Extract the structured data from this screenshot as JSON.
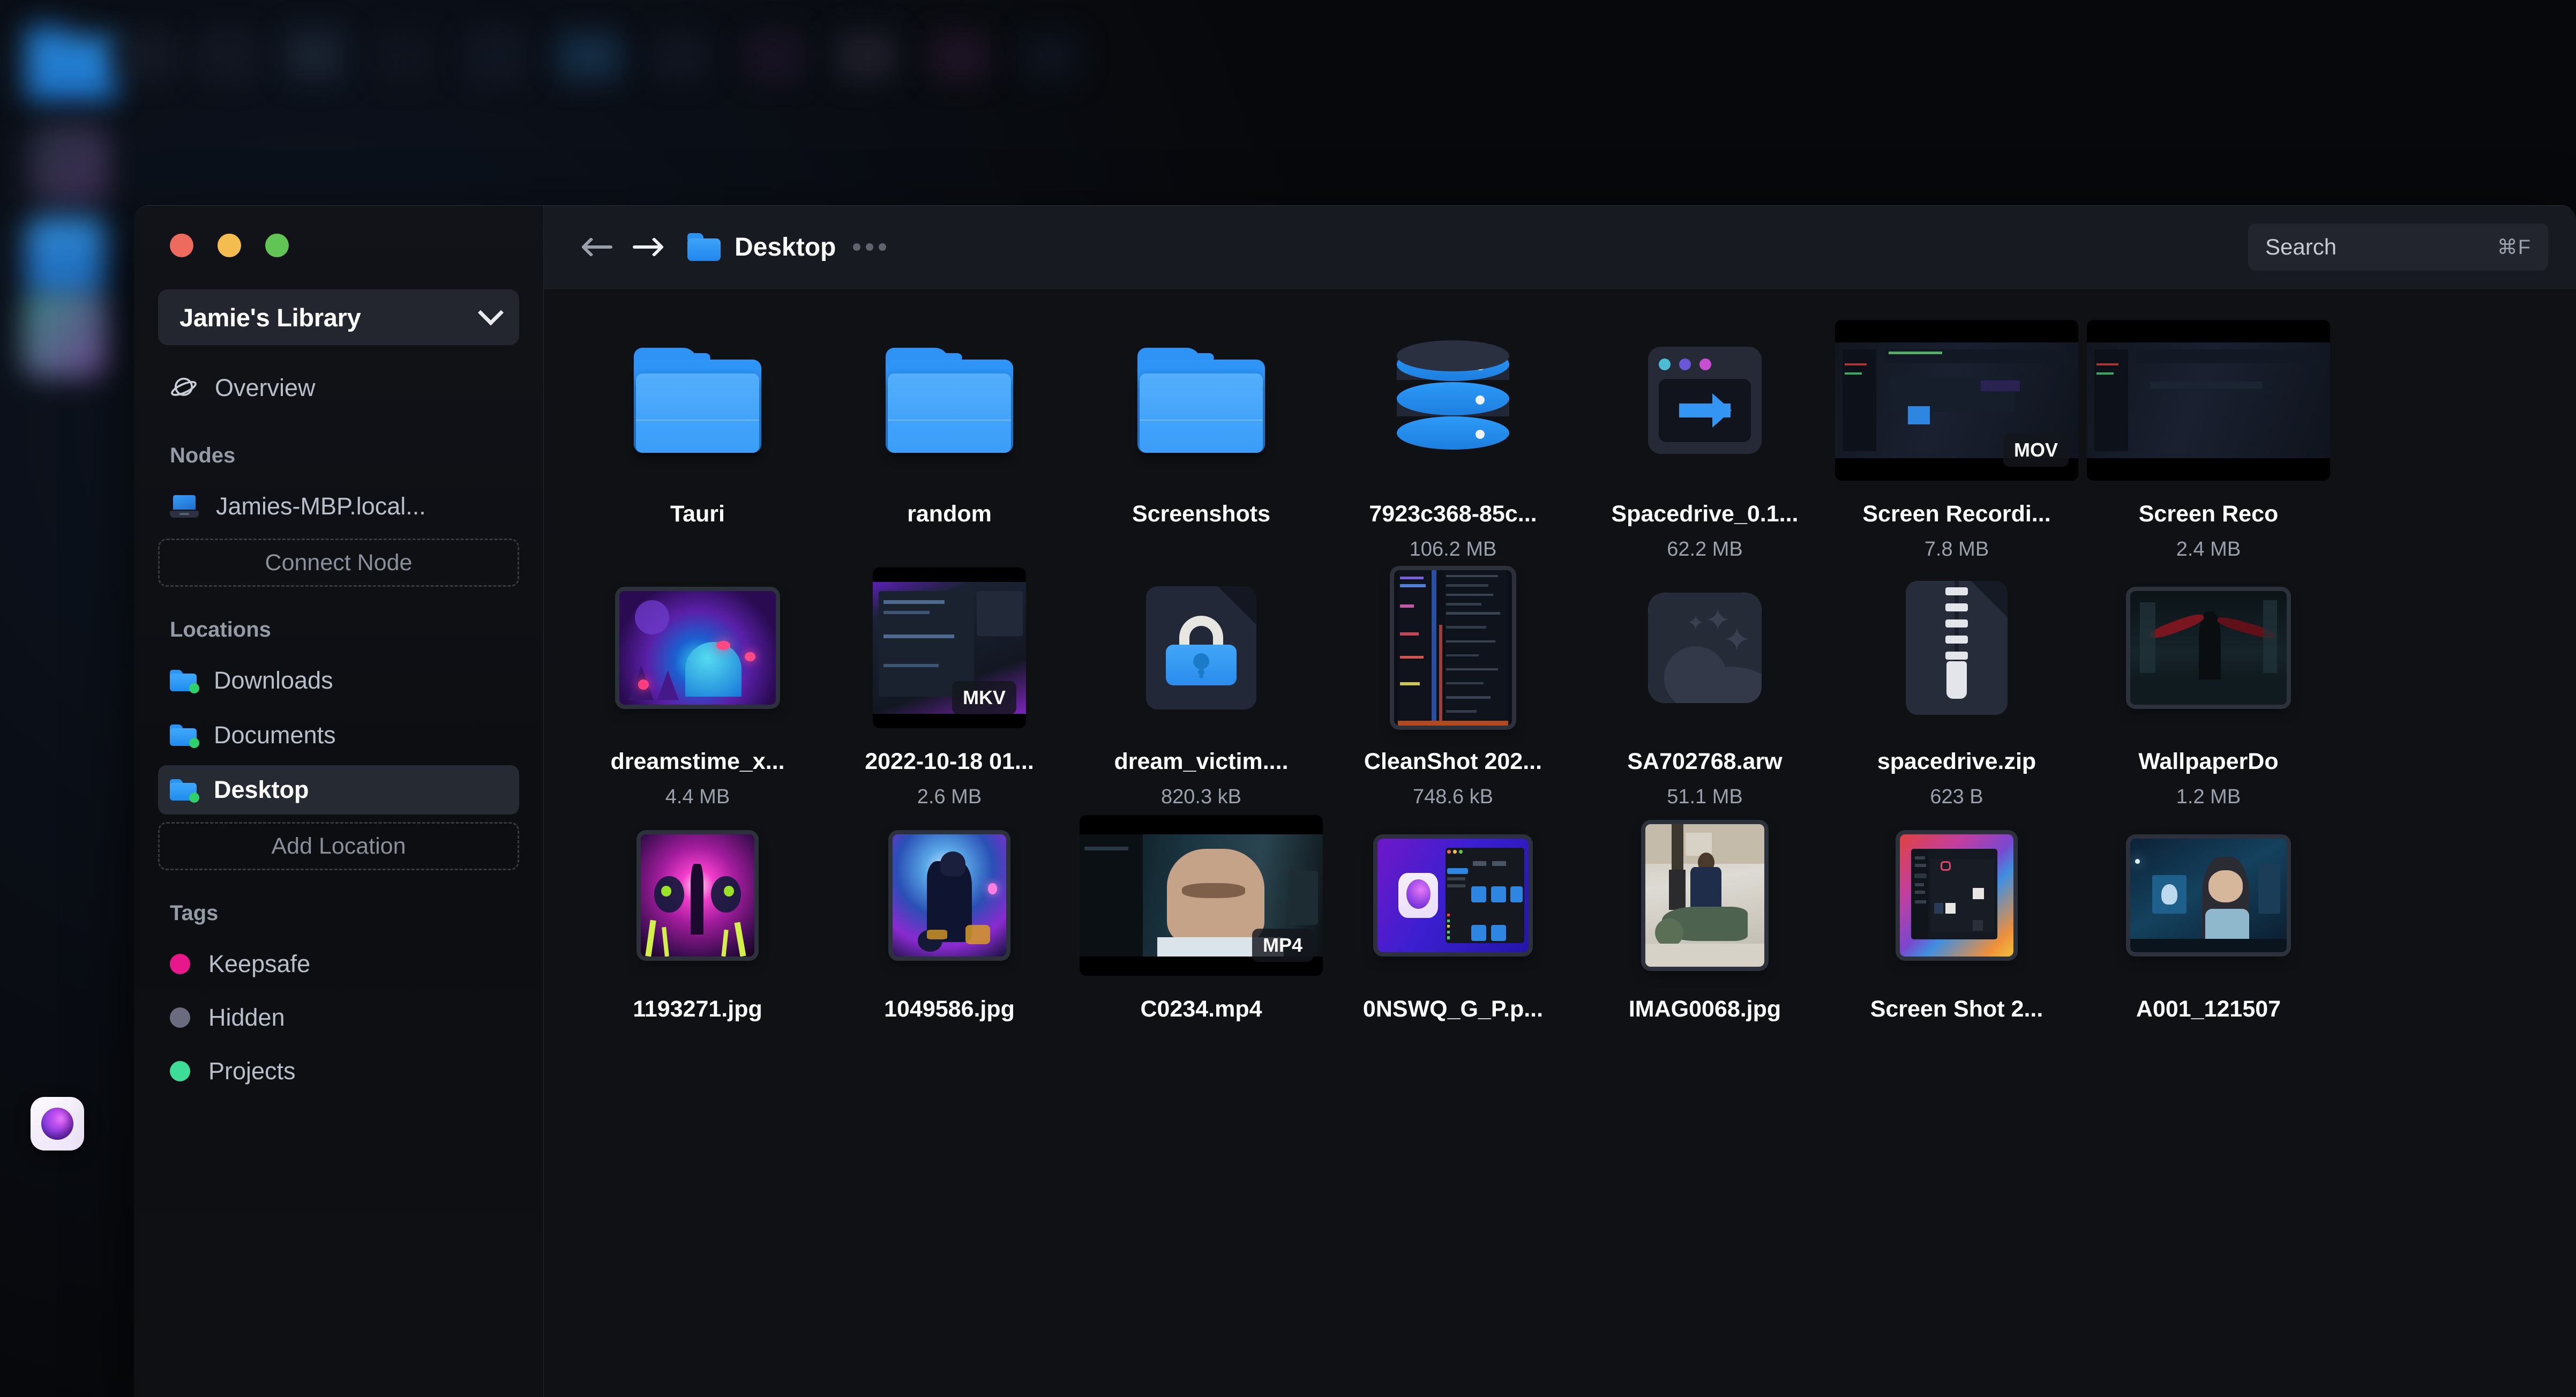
{
  "app": {
    "dock_icon_name": "spacedrive-app-icon"
  },
  "window": {
    "traffic_lights": [
      "close",
      "minimize",
      "zoom"
    ],
    "traffic_colors": {
      "close": "#ec6a5e",
      "minimize": "#f4bd4f",
      "zoom": "#61c454"
    }
  },
  "sidebar": {
    "library_switcher": {
      "label": "Jamie's Library",
      "chevron": "chevron-down-icon"
    },
    "overview": {
      "label": "Overview",
      "icon": "planet-icon"
    },
    "sections": [
      {
        "title": "Nodes",
        "items": [
          {
            "label": "Jamies-MBP.local...",
            "icon": "laptop-icon"
          }
        ],
        "action": "Connect Node"
      },
      {
        "title": "Locations",
        "items": [
          {
            "label": "Downloads",
            "icon": "folder-icon",
            "selected": false
          },
          {
            "label": "Documents",
            "icon": "folder-icon",
            "selected": false
          },
          {
            "label": "Desktop",
            "icon": "folder-icon",
            "selected": true
          }
        ],
        "action": "Add Location"
      },
      {
        "title": "Tags",
        "tags": [
          {
            "label": "Keepsafe",
            "color": "#e8188c"
          },
          {
            "label": "Hidden",
            "color": "#6b6b80"
          },
          {
            "label": "Projects",
            "color": "#3ddc97"
          }
        ]
      }
    ]
  },
  "toolbar": {
    "back": "back-arrow",
    "forward": "forward-arrow",
    "breadcrumb": {
      "label": "Desktop",
      "icon": "folder-icon"
    },
    "overflow": "more-options",
    "search": {
      "placeholder": "Search",
      "value": "",
      "shortcut": "⌘F"
    }
  },
  "files": [
    {
      "name": "Tauri",
      "size": "",
      "kind": "folder"
    },
    {
      "name": "random",
      "size": "",
      "kind": "folder"
    },
    {
      "name": "Screenshots",
      "size": "",
      "kind": "folder"
    },
    {
      "name": "7923c368-85c...",
      "size": "106.2 MB",
      "kind": "database"
    },
    {
      "name": "Spacedrive_0.1...",
      "size": "62.2 MB",
      "kind": "dmg"
    },
    {
      "name": "Screen Recordi...",
      "size": "7.8 MB",
      "kind": "video",
      "badge": "MOV"
    },
    {
      "name": "Screen Reco",
      "size": "2.4 MB",
      "kind": "video",
      "badge": ""
    },
    {
      "name": "dreamstime_x...",
      "size": "4.4 MB",
      "kind": "image-neon"
    },
    {
      "name": "2022-10-18 01...",
      "size": "2.6 MB",
      "kind": "video",
      "badge": "MKV"
    },
    {
      "name": "dream_victim....",
      "size": "820.3 kB",
      "kind": "locked-doc"
    },
    {
      "name": "CleanShot 202...",
      "size": "748.6 kB",
      "kind": "image-code"
    },
    {
      "name": "SA702768.arw",
      "size": "51.1 MB",
      "kind": "raw-image"
    },
    {
      "name": "spacedrive.zip",
      "size": "623 B",
      "kind": "zip"
    },
    {
      "name": "WallpaperDo",
      "size": "1.2 MB",
      "kind": "image-dark"
    },
    {
      "name": "1193271.jpg",
      "size": "",
      "kind": "image-magenta"
    },
    {
      "name": "1049586.jpg",
      "size": "",
      "kind": "image-blue"
    },
    {
      "name": "C0234.mp4",
      "size": "",
      "kind": "video",
      "badge": "MP4"
    },
    {
      "name": "0NSWQ_G_P.p...",
      "size": "",
      "kind": "image-purple-ui"
    },
    {
      "name": "IMAG0068.jpg",
      "size": "",
      "kind": "image-photo"
    },
    {
      "name": "Screen Shot 2...",
      "size": "",
      "kind": "image-macos"
    },
    {
      "name": "A001_121507",
      "size": "",
      "kind": "image-person"
    }
  ]
}
